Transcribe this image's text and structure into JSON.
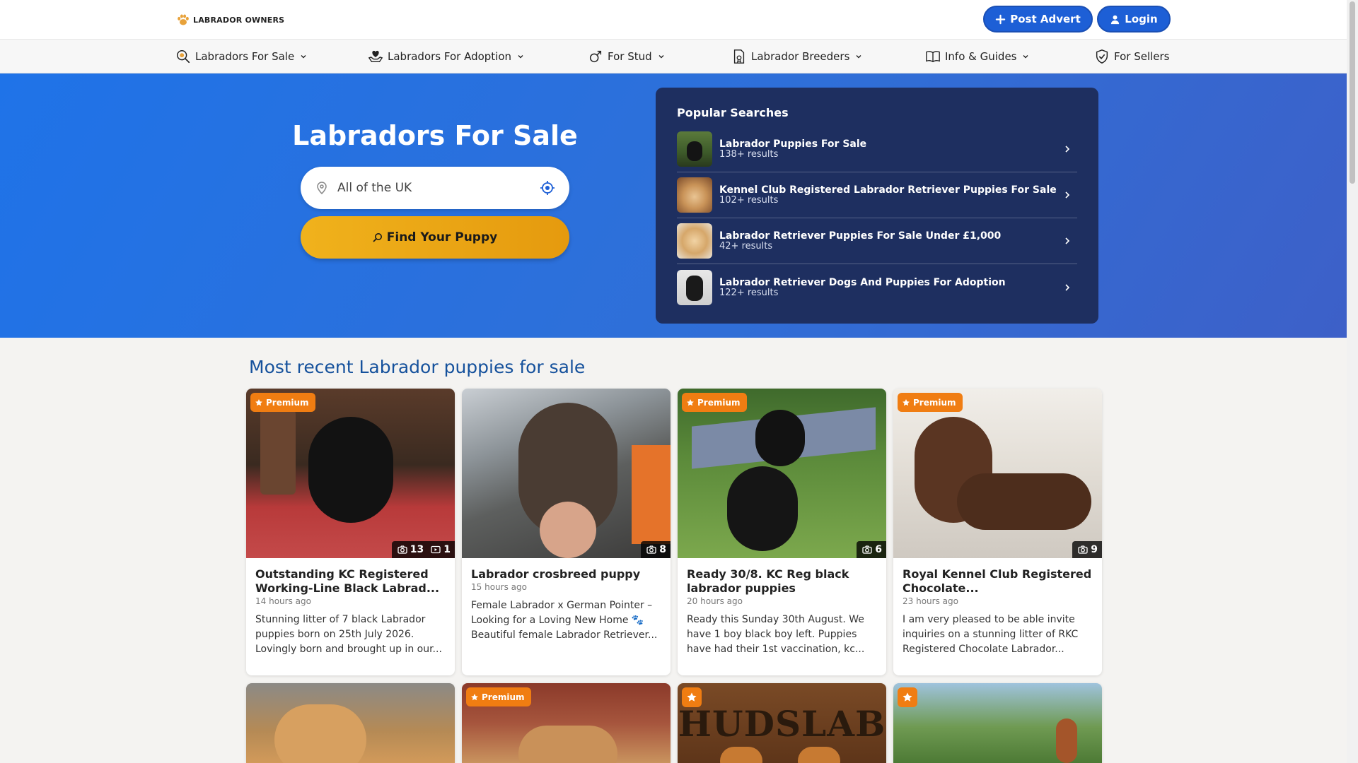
{
  "header": {
    "logo_text": "LABRADOR OWNERS",
    "post_advert_label": "Post Advert",
    "login_label": "Login",
    "brand_color": "#1d5fd6"
  },
  "nav": {
    "items": [
      {
        "label": "Labradors For Sale",
        "icon": "search-dog-icon"
      },
      {
        "label": "Labradors For Adoption",
        "icon": "heart-hand-icon"
      },
      {
        "label": "For Stud",
        "icon": "male-icon"
      },
      {
        "label": "Labrador Breeders",
        "icon": "certificate-icon"
      },
      {
        "label": "Info & Guides",
        "icon": "book-icon"
      },
      {
        "label": "For Sellers",
        "icon": "shield-check-icon"
      }
    ]
  },
  "hero": {
    "title": "Labradors For Sale",
    "location_value": "All of the UK",
    "find_label": "Find Your Puppy"
  },
  "popular": {
    "title": "Popular Searches",
    "items": [
      {
        "name": "Labrador Puppies For Sale",
        "count": "138+ results"
      },
      {
        "name": "Kennel Club Registered Labrador Retriever Puppies For Sale",
        "count": "102+ results"
      },
      {
        "name": "Labrador Retriever Puppies For Sale Under £1,000",
        "count": "42+ results"
      },
      {
        "name": "Labrador Retriever Dogs And Puppies For Adoption",
        "count": "122+ results"
      }
    ]
  },
  "listings": {
    "section_title": "Most recent Labrador puppies for sale",
    "premium_label": "Premium",
    "cards": [
      {
        "premium": true,
        "photos": "13",
        "videos": "1",
        "title": "Outstanding KC Registered Working-Line Black Labrad...",
        "time": "14 hours ago",
        "desc": "Stunning litter of 7 black Labrador puppies born on 25th July 2026. Lovingly born and brought up in our..."
      },
      {
        "premium": false,
        "photos": "8",
        "title": "Labrador crosbreed puppy",
        "time": "15 hours ago",
        "desc": "Female Labrador x German Pointer – Looking for a Loving New Home 🐾 Beautiful female Labrador Retriever..."
      },
      {
        "premium": true,
        "photos": "6",
        "title": "Ready 30/8. KC Reg black labrador puppies",
        "time": "20 hours ago",
        "desc": "Ready this Sunday 30th August. We have 1 boy black boy left. Puppies have had their 1st vaccination, kc..."
      },
      {
        "premium": true,
        "photos": "9",
        "title": "Royal Kennel Club Registered Chocolate...",
        "time": "23 hours ago",
        "desc": "I am very pleased to be able invite inquiries on a stunning litter of  RKC Registered Chocolate Labrador..."
      }
    ],
    "second_row_sign_text": "HUDSLAB"
  },
  "colors": {
    "hero_blue": "#2f6fd8",
    "popular_bg": "#1e2f60",
    "find_button": "#f0b21c",
    "premium_orange": "#f07d12",
    "section_title": "#15519c"
  }
}
